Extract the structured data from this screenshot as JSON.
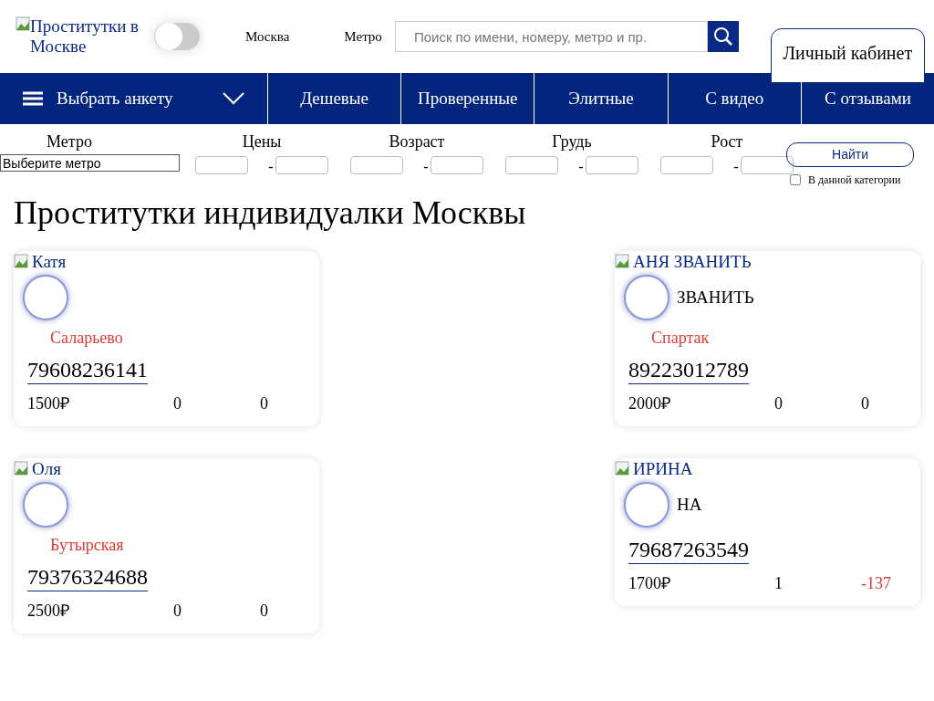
{
  "header": {
    "logo_alt": "Проститутки в Москве",
    "theme_switch": {
      "on": false
    },
    "city": "Москва",
    "metro": "Метро",
    "search": {
      "placeholder": "Поиск по имени, номеру, метро и пр."
    },
    "account_button": "Личный кабинет"
  },
  "nav": {
    "menu": "Выбрать анкету",
    "links": [
      "Дешевые",
      "Проверенные",
      "Элитные",
      "С видео",
      "С отзывами"
    ]
  },
  "filters": {
    "metro": {
      "label": "Метро",
      "value": "Выберите метро"
    },
    "ranges": [
      {
        "label": "Цены",
        "separator": "-"
      },
      {
        "label": "Возраст",
        "separator": "-"
      },
      {
        "label": "Грудь",
        "separator": "-"
      },
      {
        "label": "Рост",
        "separator": "-"
      }
    ],
    "find_button": "Найти",
    "category": {
      "label": "В данной категории",
      "checked": false
    }
  },
  "title": "Проститутки индивидуалки Москвы",
  "cards": [
    {
      "photo_alt": "Катя",
      "location": "Саларьево",
      "phone": "79608236141",
      "price": "1500₽",
      "stat_1": "0",
      "stat_2": "0",
      "stat_2_negative": false
    },
    {
      "photo_alt": "АНЯ ЗВАНИТЬ",
      "name": "ЗВАНИТЬ",
      "location": "Спартак",
      "phone": "89223012789",
      "price": "2000₽",
      "stat_1": "0",
      "stat_2": "0",
      "stat_2_negative": false
    },
    {
      "photo_alt": "Оля",
      "location": "Бутырская",
      "phone": "79376324688",
      "price": "2500₽",
      "stat_1": "0",
      "stat_2": "0",
      "stat_2_negative": false
    },
    {
      "photo_alt": "ИРИНА",
      "name": "НА",
      "phone": "79687263549",
      "price": "1700₽",
      "stat_1": "1",
      "stat_2": "-137",
      "stat_2_negative": true
    }
  ]
}
